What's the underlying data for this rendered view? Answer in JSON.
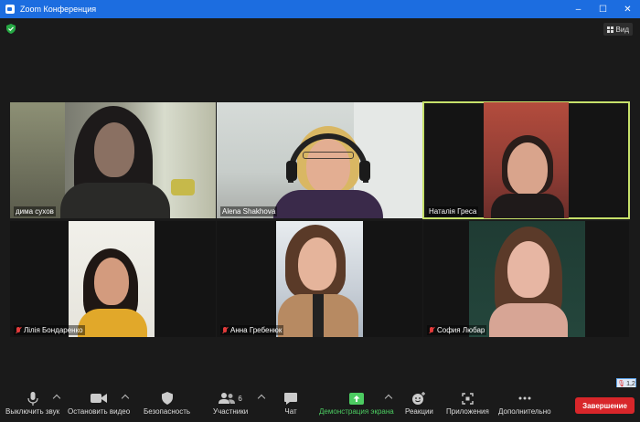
{
  "window": {
    "title": "Zoom Конференция",
    "minimize": "–",
    "maximize": "☐",
    "close": "✕"
  },
  "view": {
    "label": "Вид"
  },
  "participants": [
    {
      "name": "дима сухов",
      "muted": false
    },
    {
      "name": "Alena Shakhova",
      "muted": false
    },
    {
      "name": "Наталія Греса",
      "muted": false
    },
    {
      "name": "Лілія Бондаренко",
      "muted": true
    },
    {
      "name": "Анна Гребенюк",
      "muted": true
    },
    {
      "name": "София Любар",
      "muted": true
    }
  ],
  "toolbar": {
    "mute_label": "Выключить звук",
    "video_label": "Остановить видео",
    "security_label": "Безопасность",
    "participants_label": "Участники",
    "participants_count": "6",
    "chat_label": "Чат",
    "share_label": "Демонстрация экрана",
    "reactions_label": "Реакции",
    "apps_label": "Приложения",
    "more_label": "Дополнительно",
    "end_label": "Завершение"
  },
  "audio_meter": {
    "value": "1,2"
  },
  "colors": {
    "titlebar": "#1c6de0",
    "active_speaker": "#c6e06a",
    "share_green": "#4ccb61",
    "end_red": "#d8262a",
    "muted_red": "#e23b3b"
  }
}
